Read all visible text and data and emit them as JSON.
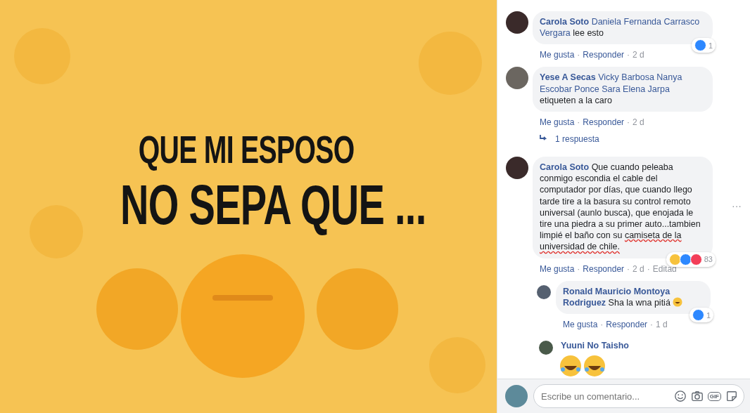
{
  "post_image": {
    "caption_lines": [
      "QUE MI ESPOSO",
      "NO SEPA QUE ..."
    ]
  },
  "separator": "·",
  "comments": [
    {
      "kind": "comment",
      "parts": [
        {
          "kind": "name",
          "text": "Carola Soto"
        },
        {
          "kind": "mention",
          "text": "Daniela Fernanda Carrasco Vergara"
        },
        {
          "kind": "text",
          "text": "lee esto"
        }
      ],
      "meta": [
        "Me gusta",
        "Responder"
      ],
      "time": [
        "2 d"
      ],
      "reactions": {
        "icons": [
          {
            "kind": "like"
          }
        ],
        "count": "1"
      }
    },
    {
      "kind": "comment",
      "parts": [
        {
          "kind": "name",
          "text": "Yese A Secas"
        },
        {
          "kind": "mention",
          "text": "Vicky Barbosa Nanya Escobar Ponce Sara Elena Jarpa"
        },
        {
          "kind": "text",
          "text": "etiqueten a la caro"
        }
      ],
      "meta": [
        "Me gusta",
        "Responder"
      ],
      "time": [
        "2 d"
      ],
      "replies_link": "1 respuesta"
    },
    {
      "kind": "comment",
      "more": "···",
      "parts": [
        {
          "kind": "name",
          "text": "Carola Soto"
        },
        {
          "kind": "text",
          "text": "Que cuando peleaba conmigo escondia el cable del computador por días, que cuando llego tarde tire a la basura su control remoto universal (aunlo busca), que enojada le tire una piedra a su primer auto...tambien limpié el baño con su"
        },
        {
          "kind": "misspelled",
          "text": "camiseta de la universidad de chile."
        }
      ],
      "meta": [
        "Me gusta",
        "Responder"
      ],
      "time": [
        "2 d",
        "Editad"
      ],
      "reactions": {
        "icons": [
          {
            "kind": "haha"
          },
          {
            "kind": "like"
          },
          {
            "kind": "love"
          }
        ],
        "count": "83"
      }
    },
    {
      "kind": "reply",
      "parts": [
        {
          "kind": "name",
          "text": "Ronald Mauricio Montoya Rodriguez"
        },
        {
          "kind": "text",
          "text": "Sha la wna pitiá"
        },
        {
          "kind": "emoji"
        }
      ],
      "meta": [
        "Me gusta",
        "Responder"
      ],
      "time": [
        "1 d"
      ],
      "reactions": {
        "icons": [
          {
            "kind": "like"
          }
        ],
        "count": "1"
      }
    },
    {
      "kind": "emoji_reply",
      "parts": [
        {
          "kind": "name",
          "text": "Yuuni No Taisho"
        }
      ],
      "emojis": [
        {
          "kind": "laugh"
        },
        {
          "kind": "laugh"
        }
      ]
    }
  ],
  "composer": {
    "placeholder": "Escribe un comentario...",
    "gif_label": "GIF"
  }
}
